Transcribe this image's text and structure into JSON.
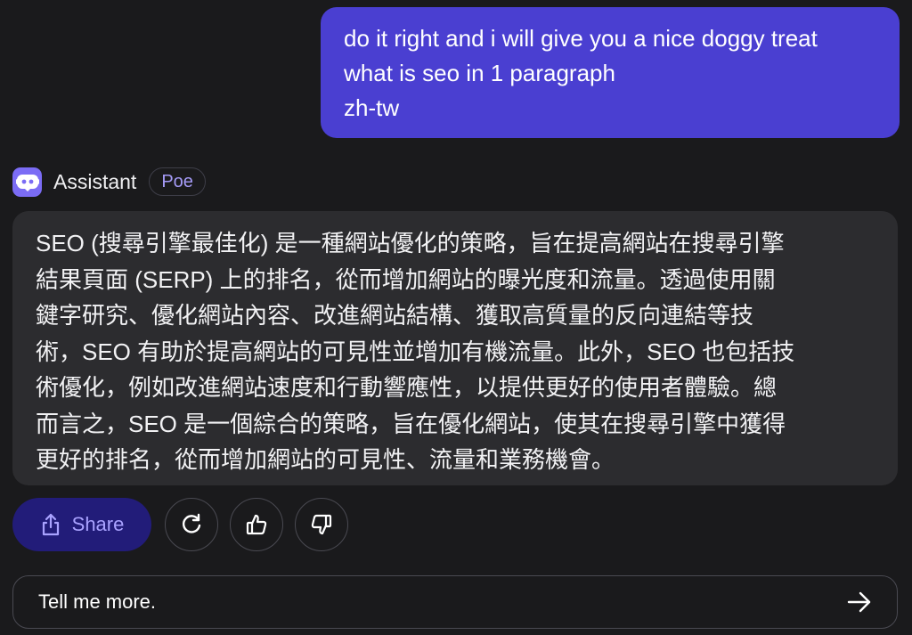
{
  "conversation": {
    "user_message": {
      "lines": [
        "do it right and i will give you a nice doggy treat",
        "what is seo in 1 paragraph",
        "zh-tw"
      ]
    },
    "bot": {
      "name": "Assistant",
      "badge": "Poe",
      "avatar_icon": "robot-icon",
      "accent_color": "#7b6cf5",
      "message_lines": [
        "SEO (搜尋引擎最佳化) 是一種網站優化的策略，旨在提高網站在搜尋引擎",
        "結果頁面 (SERP) 上的排名，從而增加網站的曝光度和流量。透過使用關",
        "鍵字研究、優化網站內容、改進網站結構、獲取高質量的反向連結等技",
        "術，SEO 有助於提高網站的可見性並增加有機流量。此外，SEO 也包括技",
        "術優化，例如改進網站速度和行動響應性，以提供更好的使用者體驗。總",
        "而言之，SEO 是一個綜合的策略，旨在優化網站，使其在搜尋引擎中獲得",
        "更好的排名，從而增加網站的可見性、流量和業務機會。"
      ]
    }
  },
  "actions": {
    "share_label": "Share",
    "share_icon": "share-icon",
    "retry_icon": "refresh-icon",
    "like_icon": "thumbs-up-icon",
    "dislike_icon": "thumbs-down-icon"
  },
  "composer": {
    "value": "Tell me more.",
    "send_icon": "arrow-right-icon"
  },
  "colors": {
    "background": "#1a1a1c",
    "user_bubble": "#4a3fd1",
    "bot_bubble": "#2c2c2f",
    "share_button": "#221c79",
    "share_text": "#a9a2ff",
    "badge_text": "#a59bf7"
  }
}
